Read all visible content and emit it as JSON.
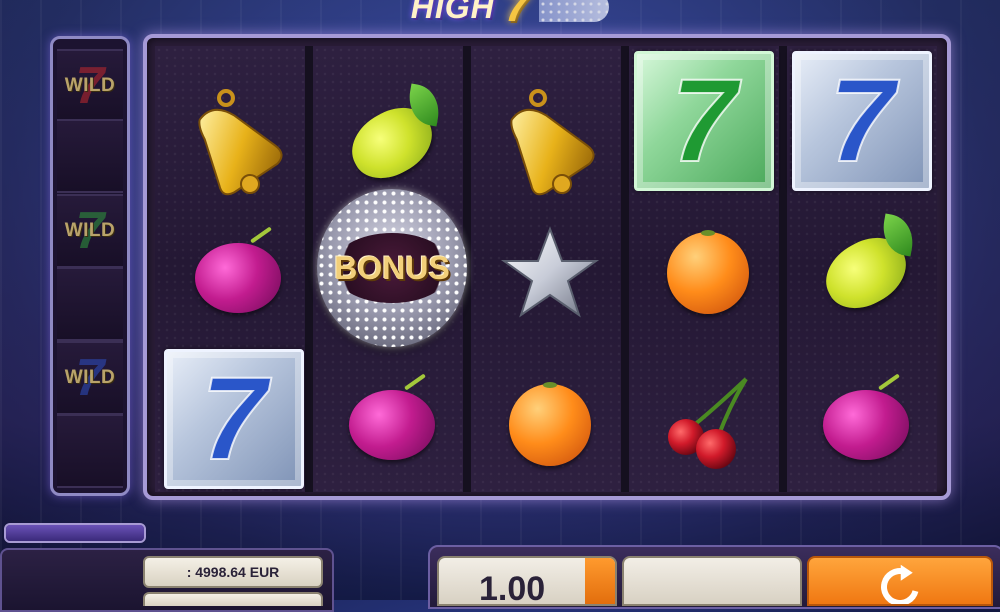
{
  "game": {
    "logo_text": "HIGH",
    "logo_seven": "7"
  },
  "wild_column": {
    "items": [
      {
        "label": "WILD",
        "seven": "7",
        "color": "#c0282e"
      },
      {
        "label": "WILD",
        "seven": "7",
        "color": "#2f9a3e"
      },
      {
        "label": "WILD",
        "seven": "7",
        "color": "#2e4fc2"
      }
    ]
  },
  "reels": [
    {
      "symbols": [
        "bell",
        "plum",
        "seven-blue"
      ]
    },
    {
      "symbols": [
        "lemon",
        "bonus",
        "plum"
      ]
    },
    {
      "symbols": [
        "bell",
        "star",
        "orange"
      ]
    },
    {
      "symbols": [
        "seven-green",
        "orange",
        "cherries"
      ]
    },
    {
      "symbols": [
        "seven-blue",
        "lemon",
        "plum"
      ]
    }
  ],
  "bonus": {
    "label": "BONUS"
  },
  "sevens": {
    "glyph": "7",
    "green_color": "#1f9a33",
    "blue_color": "#2a56c9"
  },
  "balance": {
    "text": ": 4998.64 EUR"
  },
  "bet": {
    "value": "1.00"
  },
  "colors": {
    "frame": "#a69ad6",
    "spin_button": "#f07812",
    "accent_gold": "#f2cf7a"
  },
  "icons": [
    "bell-icon",
    "plum-icon",
    "lemon-icon",
    "orange-icon",
    "star-icon",
    "cherries-icon",
    "spin-icon"
  ]
}
